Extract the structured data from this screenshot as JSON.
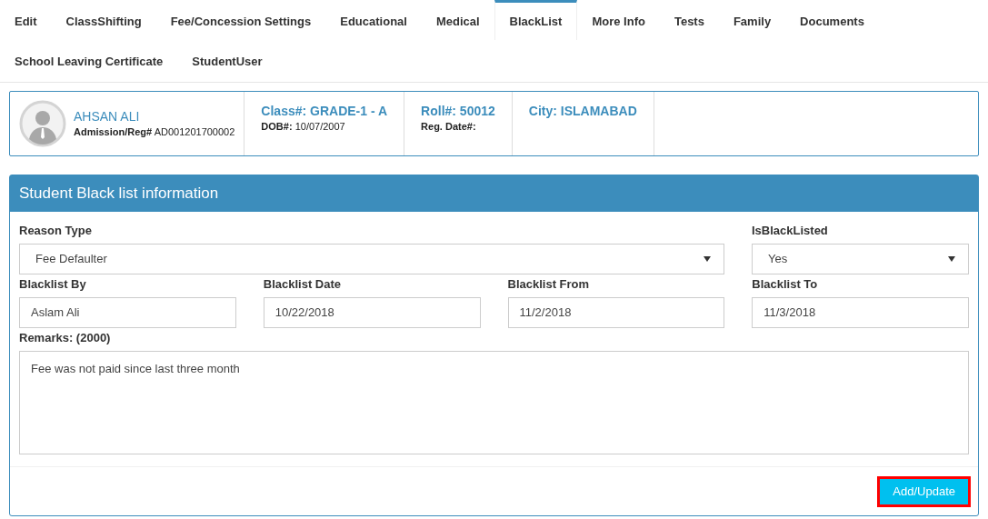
{
  "tabs": [
    {
      "label": "Edit",
      "selected": false
    },
    {
      "label": "ClassShifting",
      "selected": false
    },
    {
      "label": "Fee/Concession Settings",
      "selected": false
    },
    {
      "label": "Educational",
      "selected": false
    },
    {
      "label": "Medical",
      "selected": false
    },
    {
      "label": "BlackList",
      "selected": true
    },
    {
      "label": "More Info",
      "selected": false
    },
    {
      "label": "Tests",
      "selected": false
    },
    {
      "label": "Family",
      "selected": false
    },
    {
      "label": "Documents",
      "selected": false
    },
    {
      "label": "School Leaving Certificate",
      "selected": false
    },
    {
      "label": "StudentUser",
      "selected": false
    }
  ],
  "student": {
    "name": "AHSAN ALI",
    "admission_label": "Admission/Reg#",
    "admission": "AD001201700002",
    "class": "Class#: GRADE-1 - A",
    "dob_label": "DOB#:",
    "dob": "10/07/2007",
    "roll": "Roll#: 50012",
    "reg_date_label": "Reg. Date#:",
    "city": "City: ISLAMABAD"
  },
  "panel": {
    "title": "Student Black list information",
    "reason_type": {
      "label": "Reason Type",
      "value": "Fee Defaulter"
    },
    "is_blacklisted": {
      "label": "IsBlackListed",
      "value": "Yes"
    },
    "fields": [
      {
        "label": "Blacklist By",
        "value": "Aslam Ali"
      },
      {
        "label": "Blacklist Date",
        "value": "10/22/2018"
      },
      {
        "label": "Blacklist From",
        "value": "11/2/2018"
      },
      {
        "label": "Blacklist To",
        "value": "11/3/2018"
      }
    ],
    "remarks": {
      "label": "Remarks: (2000)",
      "value": "Fee was not paid since last three month"
    },
    "button": "Add/Update"
  }
}
